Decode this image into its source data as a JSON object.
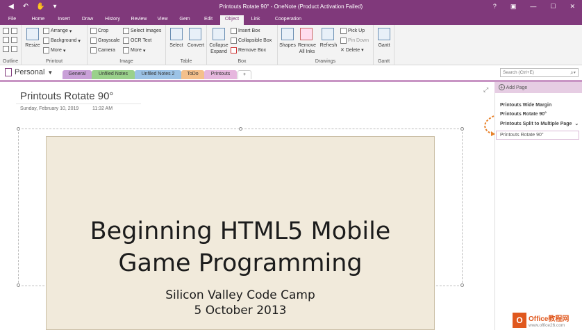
{
  "window": {
    "title": "Printouts Rotate 90° - OneNote (Product Activation Failed)",
    "help": "?",
    "restore": "▣",
    "minimize": "—",
    "maximize": "☐",
    "close": "✕"
  },
  "qat": {
    "back": "◀",
    "undo": "↶",
    "touch": "✋",
    "more": "▾"
  },
  "tabs": [
    "File",
    "Home",
    "Insert",
    "Draw",
    "History",
    "Review",
    "View",
    "Gem",
    "Edit",
    "Object",
    "Link",
    "Cooperation"
  ],
  "active_tab": "Object",
  "ribbon": {
    "outline": {
      "label": "Outline"
    },
    "printout": {
      "resize": "Resize",
      "arrange": "Arrange",
      "background": "Background",
      "more": "More",
      "label": "Printout"
    },
    "image": {
      "crop": "Crop",
      "grayscale": "Grayscale",
      "camera": "Camera",
      "select_images": "Select Images",
      "ocr_text": "OCR Text",
      "more": "More",
      "label": "Image"
    },
    "table": {
      "select": "Select",
      "convert": "Convert",
      "label": "Table"
    },
    "box": {
      "collapse_expand": "Collapse Expand",
      "insert_box": "Insert Box",
      "collapsible_box": "Collapsible Box",
      "remove_box": "Remove Box",
      "label": "Box"
    },
    "drawings": {
      "shapes": "Shapes",
      "remove_all_inks": "Remove All Inks",
      "refresh": "Refresh",
      "pick_up": "Pick Up",
      "pin_down": "Pin Down",
      "delete": "Delete",
      "label": "Drawings"
    },
    "gantt": {
      "gantt": "Gantt",
      "label": "Gantt"
    }
  },
  "notebook": {
    "name": "Personal"
  },
  "sections": [
    {
      "label": "General",
      "color": "#c9a0d8"
    },
    {
      "label": "Unfiled Notes",
      "color": "#9ad18b"
    },
    {
      "label": "Unfiled Notes 2",
      "color": "#9cc3e6"
    },
    {
      "label": "ToDo",
      "color": "#f4c08b"
    },
    {
      "label": "Printouts",
      "color": "#e6b7de"
    },
    {
      "label": "+",
      "color": "#ffffff"
    }
  ],
  "search": {
    "placeholder": "Search (Ctrl+E)"
  },
  "page": {
    "title": "Printouts Rotate 90°",
    "date": "Sunday, February 10, 2019",
    "time": "11:32 AM"
  },
  "slide": {
    "line1": "Beginning HTML5 Mobile",
    "line2": "Game Programming",
    "sub1": "Silicon Valley Code Camp",
    "sub2": "5 October 2013"
  },
  "pagelist": {
    "add_page": "Add Page",
    "items": [
      "Printouts Wide Margin",
      "Printouts Rotate 90°",
      "Printouts Split to Multiple Page",
      "Printouts Rotate 90°"
    ]
  },
  "watermark": {
    "brand": "Office教程网",
    "url": "www.office26.com"
  }
}
